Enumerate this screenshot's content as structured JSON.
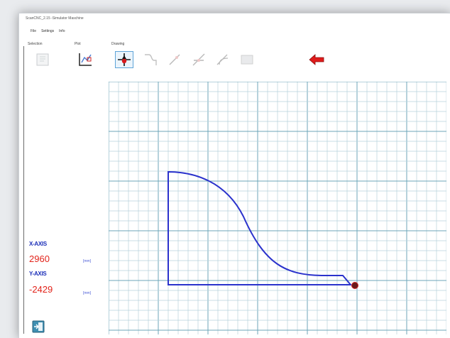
{
  "window": {
    "title": "ScanCNC_2.15 -Simulator Maschine"
  },
  "menu": {
    "items": [
      "File",
      "Settings",
      "Info"
    ]
  },
  "toolbar": {
    "groups": {
      "selection": "Selection",
      "plot": "Plot",
      "drawing": "Drawing"
    }
  },
  "readout": {
    "x_label": "X-AXIS",
    "x_value": "2960",
    "x_unit": "[mm]",
    "y_label": "Y-AXIS",
    "y_value": "-2429",
    "y_unit": "[mm]"
  },
  "colors": {
    "path": "#2a32cc",
    "grid_minor": "#b7d2dc",
    "grid_major": "#6ea6b8",
    "point": "#6a1a1a",
    "axis_label": "#1c2fb8",
    "axis_value": "#e2231a"
  }
}
